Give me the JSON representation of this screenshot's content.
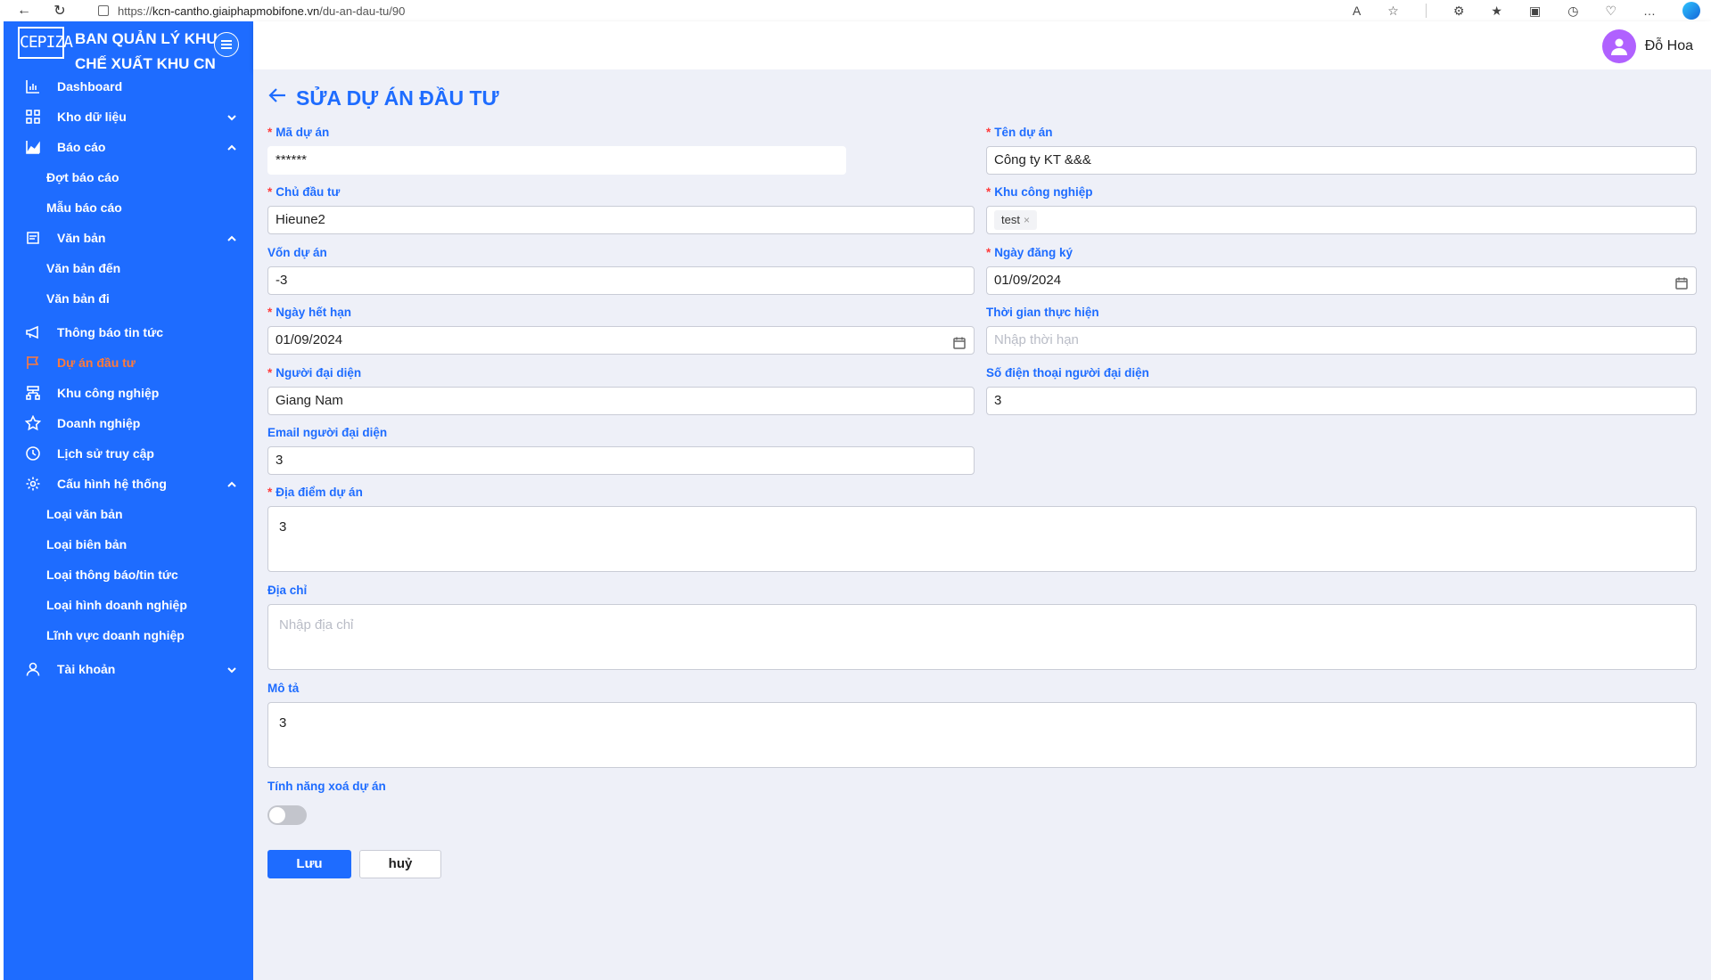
{
  "browser": {
    "url_prefix": "https://",
    "url_host": "kcn-cantho.giaiphapmobifone.vn",
    "url_path": "/du-an-dau-tu/90"
  },
  "brand": {
    "logo_text": "CEPIZA",
    "title_line1": "BAN QUẢN LÝ KHU",
    "title_line2": "CHẾ XUẤT KHU CN"
  },
  "sidebar": {
    "items": [
      {
        "label": "Dashboard",
        "icon": "chart-icon"
      },
      {
        "label": "Kho dữ liệu",
        "icon": "grid-icon"
      },
      {
        "label": "Báo cáo",
        "icon": "area-chart-icon"
      },
      {
        "label": "Đợt báo cáo"
      },
      {
        "label": "Mẫu báo cáo"
      },
      {
        "label": "Văn bản",
        "icon": "document-icon"
      },
      {
        "label": "Văn bản đến"
      },
      {
        "label": "Văn bản đi"
      },
      {
        "label": "Thông báo tin tức",
        "icon": "megaphone-icon"
      },
      {
        "label": "Dự án đầu tư",
        "icon": "flag-icon"
      },
      {
        "label": "Khu công nghiệp",
        "icon": "building-icon"
      },
      {
        "label": "Doanh nghiệp",
        "icon": "star-icon"
      },
      {
        "label": "Lịch sử truy cập",
        "icon": "history-icon"
      },
      {
        "label": "Cấu hình hệ thống",
        "icon": "gear-icon"
      },
      {
        "label": "Loại văn bản"
      },
      {
        "label": "Loại biên bản"
      },
      {
        "label": "Loại thông báo/tin tức"
      },
      {
        "label": "Loại hình doanh nghiệp"
      },
      {
        "label": "Lĩnh vực doanh nghiệp"
      },
      {
        "label": "Tài khoản",
        "icon": "user-icon"
      }
    ]
  },
  "header": {
    "user_name": "Đỗ Hoa"
  },
  "page": {
    "title": "SỬA DỰ ÁN ĐẦU TƯ"
  },
  "form": {
    "ma_du_an": {
      "label": "Mã dự án",
      "value": "******"
    },
    "ten_du_an": {
      "label": "Tên dự án",
      "value": "Công ty KT &&&"
    },
    "chu_dau_tu": {
      "label": "Chủ đầu tư",
      "value": "Hieune2"
    },
    "khu_cong_nghiep": {
      "label": "Khu công nghiệp",
      "tag": "test",
      "tag_remove": "×"
    },
    "von_du_an": {
      "label": "Vốn dự án",
      "value": "-3"
    },
    "ngay_dang_ky": {
      "label": "Ngày đăng ký",
      "value": "01/09/2024"
    },
    "ngay_het_han": {
      "label": "Ngày hết hạn",
      "value": "01/09/2024"
    },
    "thoi_gian_thuc_hien": {
      "label": "Thời gian thực hiện",
      "placeholder": "Nhập thời hạn"
    },
    "nguoi_dai_dien": {
      "label": "Người đại diện",
      "value": "Giang Nam"
    },
    "sdt_nguoi_dai_dien": {
      "label": "Số điện thoại người đại diện",
      "value": "3"
    },
    "email_nguoi_dai_dien": {
      "label": "Email người đại diện",
      "value": "3"
    },
    "dia_diem_du_an": {
      "label": "Địa điểm dự án",
      "value": "3"
    },
    "dia_chi": {
      "label": "Địa chỉ",
      "placeholder": "Nhập địa chỉ"
    },
    "mo_ta": {
      "label": "Mô tả",
      "value": "3"
    },
    "tinh_nang_xoa": {
      "label": "Tính năng xoá dự án",
      "enabled": false
    },
    "required_mark": "*"
  },
  "buttons": {
    "save": "Lưu",
    "cancel": "huỷ"
  },
  "colors": {
    "primary": "#1e6cff",
    "active_menu": "#ff7a3a",
    "required": "#ff3b3b",
    "background": "#eef0f8"
  }
}
